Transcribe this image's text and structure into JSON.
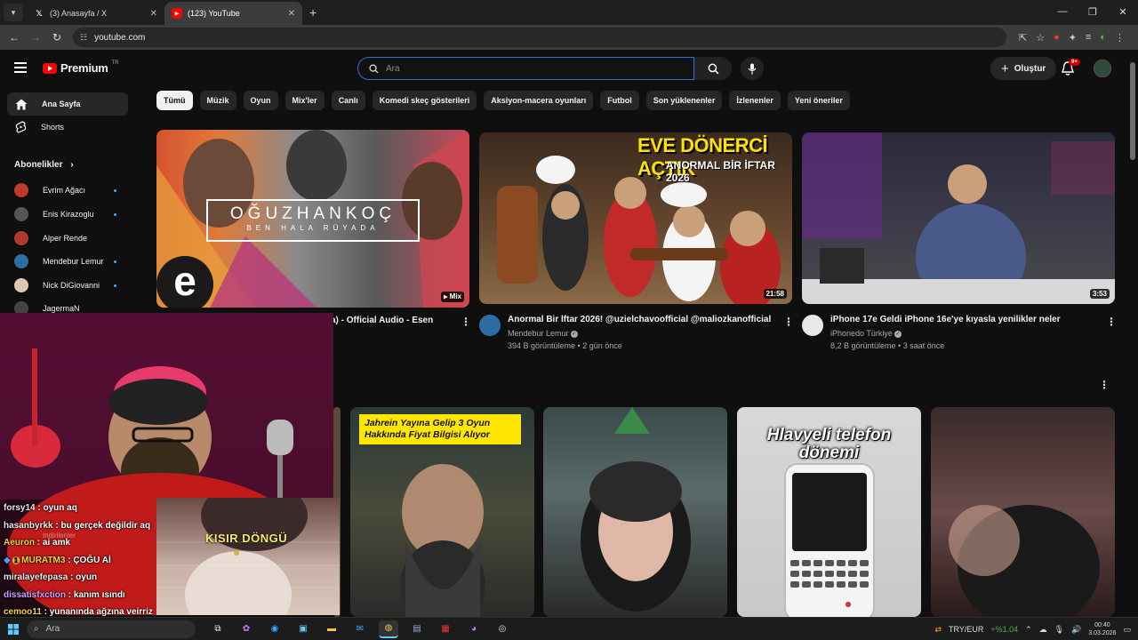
{
  "browser": {
    "tabs": [
      {
        "title": "(3) Anasayfa / X",
        "icon": "x-logo-icon",
        "active": false
      },
      {
        "title": "(123) YouTube",
        "icon": "youtube-logo-icon",
        "active": true
      }
    ],
    "url": "youtube.com"
  },
  "header": {
    "logo_text": "Premium",
    "logo_region": "TR",
    "search_placeholder": "Ara",
    "create_label": "Oluştur",
    "notification_badge": "9+"
  },
  "sidebar": {
    "items": [
      {
        "label": "Ana Sayfa",
        "icon": "home-icon"
      },
      {
        "label": "Shorts",
        "icon": "shorts-icon"
      }
    ],
    "subscriptions_title": "Abonelikler",
    "subscriptions": [
      {
        "name": "Evrim Ağacı",
        "color": "#c0392b"
      },
      {
        "name": "Enis Kirazoglu",
        "color": "#555555"
      },
      {
        "name": "Alper Rende",
        "color": "#b03a2e"
      },
      {
        "name": "Mendebur Lemur",
        "color": "#2e6da4"
      },
      {
        "name": "Nick DiGiovanni",
        "color": "#e0c8b0"
      },
      {
        "name": "JagermaN",
        "color": "#444444"
      }
    ]
  },
  "chips": [
    "Tümü",
    "Müzik",
    "Oyun",
    "Mix'ler",
    "Canlı",
    "Komedi skeç gösterileri",
    "Aksiyon-macera oyunları",
    "Futbol",
    "Son yüklenenler",
    "İzlenenler",
    "Yeni öneriler"
  ],
  "videos": [
    {
      "title": "a) - Official Audio - Esen",
      "thumb_title": "OĞUZHANKOÇ",
      "thumb_subtitle": "BEN HALA RÜYADA",
      "badge": "Mix",
      "logo_letter": "e"
    },
    {
      "title": "Anormal Bir İftar 2026! @uzielchavoofficial @maliozkanofficial",
      "channel": "Mendebur Lemur",
      "meta": "394 B görüntüleme • 2 gün önce",
      "duration": "21:58",
      "thumb_title": "EVE DÖNERCİ AÇTIK",
      "thumb_subtitle": "ANORMAL BİR İFTAR 2026"
    },
    {
      "title": "iPhone 17e Geldi iPhone 16e'ye kıyasla yenilikler neler",
      "channel": "iPhonedo Türkiye",
      "meta": "8,2 B görüntüleme • 3 saat önce",
      "duration": "3:53"
    }
  ],
  "shorts": [
    {
      "caption": "Jahrein Yayına Gelip 3 Oyun Hakkında Fiyat Bilgisi Alıyor"
    },
    {
      "caption": ""
    },
    {
      "caption": "Hlavyeli telefon dönemi"
    },
    {
      "caption": ""
    }
  ],
  "stream": {
    "overlay_text": "KISIR DÖNGÜ",
    "faded_labels": [
      "Indirilenler"
    ],
    "chat": [
      {
        "user": "forsy14",
        "msg": "oyun aq",
        "color": "#ffffff"
      },
      {
        "user": "hasanbyrkk",
        "msg": "bu gerçek değildir aq",
        "color": "#ffffff"
      },
      {
        "user": "Aeuron",
        "msg": "ai amk",
        "color": "#f5d142"
      },
      {
        "user": "MURATM3",
        "msg": "ÇOĞU Aİ",
        "color": "#f5d142",
        "badges": "1"
      },
      {
        "user": "miralayefepasa",
        "msg": "oyun",
        "color": "#ffffff"
      },
      {
        "user": "dissatisfxction",
        "msg": "kanım ısındı",
        "color": "#c9a0ff"
      },
      {
        "user": "cemoo11",
        "msg": "yunanında ağzına veirriz",
        "color": "#f5d142"
      }
    ]
  },
  "taskbar": {
    "search_label": "Ara",
    "ticker_symbol": "TRY/EUR",
    "ticker_change": "+%1.04",
    "time": "00:40",
    "date": "3.03.2026"
  }
}
